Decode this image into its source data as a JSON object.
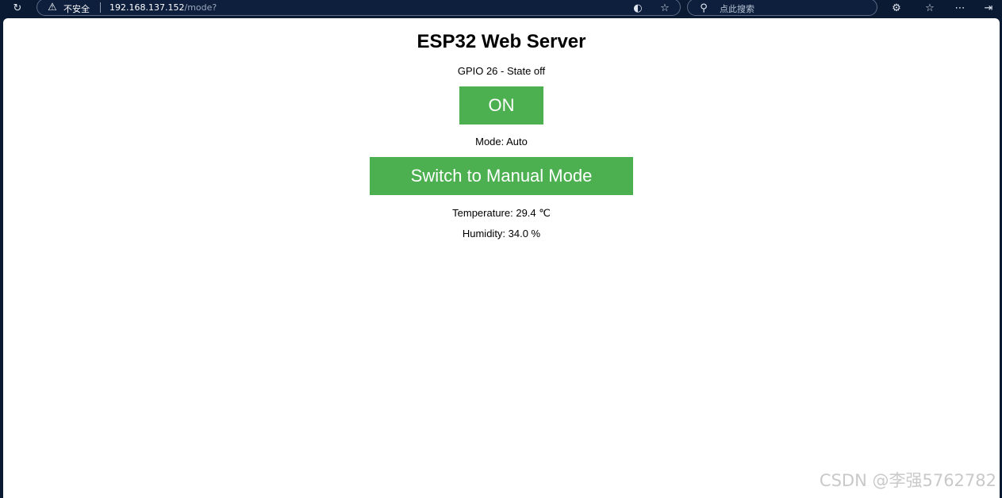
{
  "browser": {
    "security_label": "不安全",
    "url_host": "192.168.137.152",
    "url_path": "/mode?",
    "search_placeholder": "点此搜索"
  },
  "icons": {
    "refresh": "refresh-icon",
    "warning": "warning-icon",
    "tracking": "tracking-prevention-icon",
    "favorite": "star-icon",
    "search": "search-icon",
    "extensions": "extensions-icon",
    "favorites_list": "favorites-list-icon",
    "more": "more-icon",
    "exit": "exit-icon"
  },
  "page": {
    "title": "ESP32 Web Server",
    "gpio_state": "GPIO 26 - State off",
    "on_button_label": "ON",
    "mode_text": "Mode: Auto",
    "mode_button_label": "Switch to Manual Mode",
    "temperature": "Temperature: 29.4 ℃",
    "humidity": "Humidity: 34.0 %"
  },
  "colors": {
    "button_green": "#4caf50",
    "browser_dark": "#0b1a33"
  },
  "watermark": "CSDN @李强5762782"
}
